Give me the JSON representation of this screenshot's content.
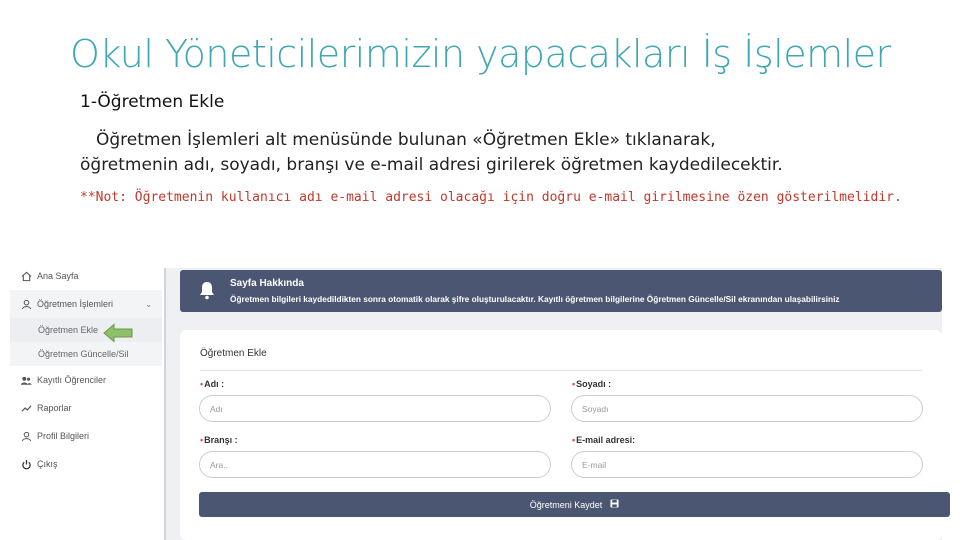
{
  "slide": {
    "title": "Okul Yöneticilerimizin yapacakları İş İşlemler",
    "section_heading": "1-Öğretmen Ekle",
    "description_line1": "Öğretmen İşlemleri alt menüsünde bulunan «Öğretmen Ekle» tıklanarak,",
    "description_line2": "öğretmenin adı, soyadı, branşı ve e-mail adresi girilerek öğretmen kaydedilecektir.",
    "note": "**Not: Öğretmenin kullanıcı adı e-mail adresi olacağı için doğru e-mail girilmesine özen gösterilmelidir."
  },
  "sidebar": {
    "items": [
      {
        "label": "Ana Sayfa",
        "icon": "home-icon"
      },
      {
        "label": "Öğretmen İşlemleri",
        "icon": "user-icon"
      },
      {
        "label": "Kayıtlı Öğrenciler",
        "icon": "users-icon"
      },
      {
        "label": "Raporlar",
        "icon": "chart-line-icon"
      },
      {
        "label": "Profil Bilgileri",
        "icon": "profile-icon"
      },
      {
        "label": "Çıkış",
        "icon": "power-icon"
      }
    ],
    "subitems": [
      {
        "label": "Öğretmen Ekle"
      },
      {
        "label": "Öğretmen Güncelle/Sil"
      }
    ]
  },
  "banner": {
    "title": "Sayfa Hakkında",
    "text": "Öğretmen bilgileri kaydedildikten sonra otomatik olarak şifre oluşturulacaktır. Kayıtlı öğretmen bilgilerine Öğretmen Güncelle/Sil ekranından ulaşabilirsiniz"
  },
  "form": {
    "title": "Öğretmen Ekle",
    "fields": {
      "ad": {
        "label": "Adı :",
        "placeholder": "Adı"
      },
      "soyad": {
        "label": "Soyadı :",
        "placeholder": "Soyadı"
      },
      "brans": {
        "label": "Branşı :",
        "placeholder": "Ara.."
      },
      "email": {
        "label": "E-mail adresi:",
        "placeholder": "E-mail"
      }
    },
    "save_label": "Öğretmeni Kaydet"
  },
  "colors": {
    "title": "#3fa7b2",
    "note": "#c0392b",
    "banner": "#4b5672",
    "arrow": "#8fbf6a"
  }
}
